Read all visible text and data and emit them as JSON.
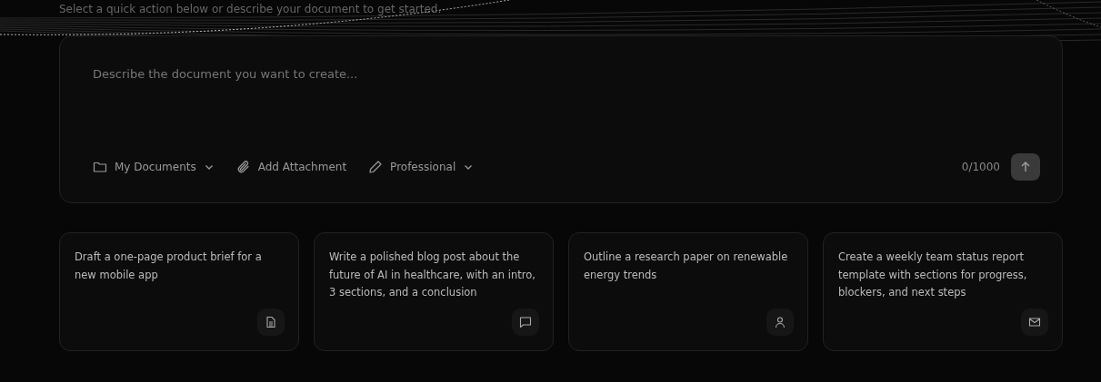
{
  "subtitle": "Select a quick action below or describe your document to get started.",
  "composer": {
    "placeholder": "Describe the document you want to create...",
    "counter": "0/1000",
    "tools": [
      {
        "kind": "folder",
        "label": "My Documents",
        "dropdown": true
      },
      {
        "kind": "attach",
        "label": "Add Attachment",
        "dropdown": false
      },
      {
        "kind": "pencil",
        "label": "Professional",
        "dropdown": true
      }
    ]
  },
  "suggestions": [
    {
      "kind": "document",
      "text": "Draft a one-page product brief for a new mobile app"
    },
    {
      "kind": "chat",
      "text": "Write a polished blog post about the future of AI in healthcare, with an intro, 3 sections, and a conclusion"
    },
    {
      "kind": "person",
      "text": "Outline a research paper on renewable energy trends"
    },
    {
      "kind": "mail",
      "text": "Create a weekly team status report template with sections for progress, blockers, and next steps"
    }
  ]
}
